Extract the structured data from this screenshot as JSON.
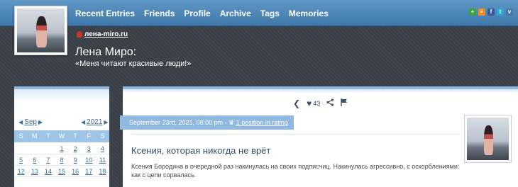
{
  "nav": {
    "items": [
      "Recent Entries",
      "Friends",
      "Profile",
      "Archive",
      "Tags",
      "Memories"
    ]
  },
  "social": {
    "icons": [
      {
        "name": "add-icon",
        "glyph": "+",
        "color": "#3aa33a"
      },
      {
        "name": "rss-icon",
        "glyph": "≡",
        "color": "#f08a24"
      },
      {
        "name": "facebook-icon",
        "glyph": "f",
        "color": "#3b5998"
      },
      {
        "name": "twitter-icon",
        "glyph": "t",
        "color": "#2aa9e0"
      },
      {
        "name": "vk-icon",
        "glyph": "v",
        "color": "#4a76a8"
      }
    ]
  },
  "header": {
    "site_link": "лена-miro.ru",
    "title": "Лена Миро:",
    "subtitle": "«Меня читают красивые люди!»"
  },
  "calendar": {
    "month": "Sep",
    "year": "2021",
    "weekdays": [
      "S",
      "M",
      "T",
      "W",
      "T",
      "F",
      "S"
    ],
    "rows": [
      [
        "",
        "",
        "",
        "1",
        "2",
        "3",
        "4"
      ],
      [
        "5",
        "6",
        "7",
        "8",
        "9",
        "10",
        "11"
      ],
      [
        "12",
        "13",
        "14",
        "15",
        "16",
        "17",
        "18"
      ]
    ]
  },
  "post": {
    "likes": "43",
    "date": "September 23rd, 2021, 08:00 pm",
    "rating": "1 position in rating",
    "title": "Ксения, которая никогда не врёт",
    "text": "Ксения Бородина в очередной раз накинулась на своих подписчиц. Накинулась агрессивно, с оскорблениями: как с цепи сорвалась."
  },
  "colors": {
    "topbar": "#4f88ba",
    "accent": "#8fb9de",
    "background": "#3b4148"
  }
}
